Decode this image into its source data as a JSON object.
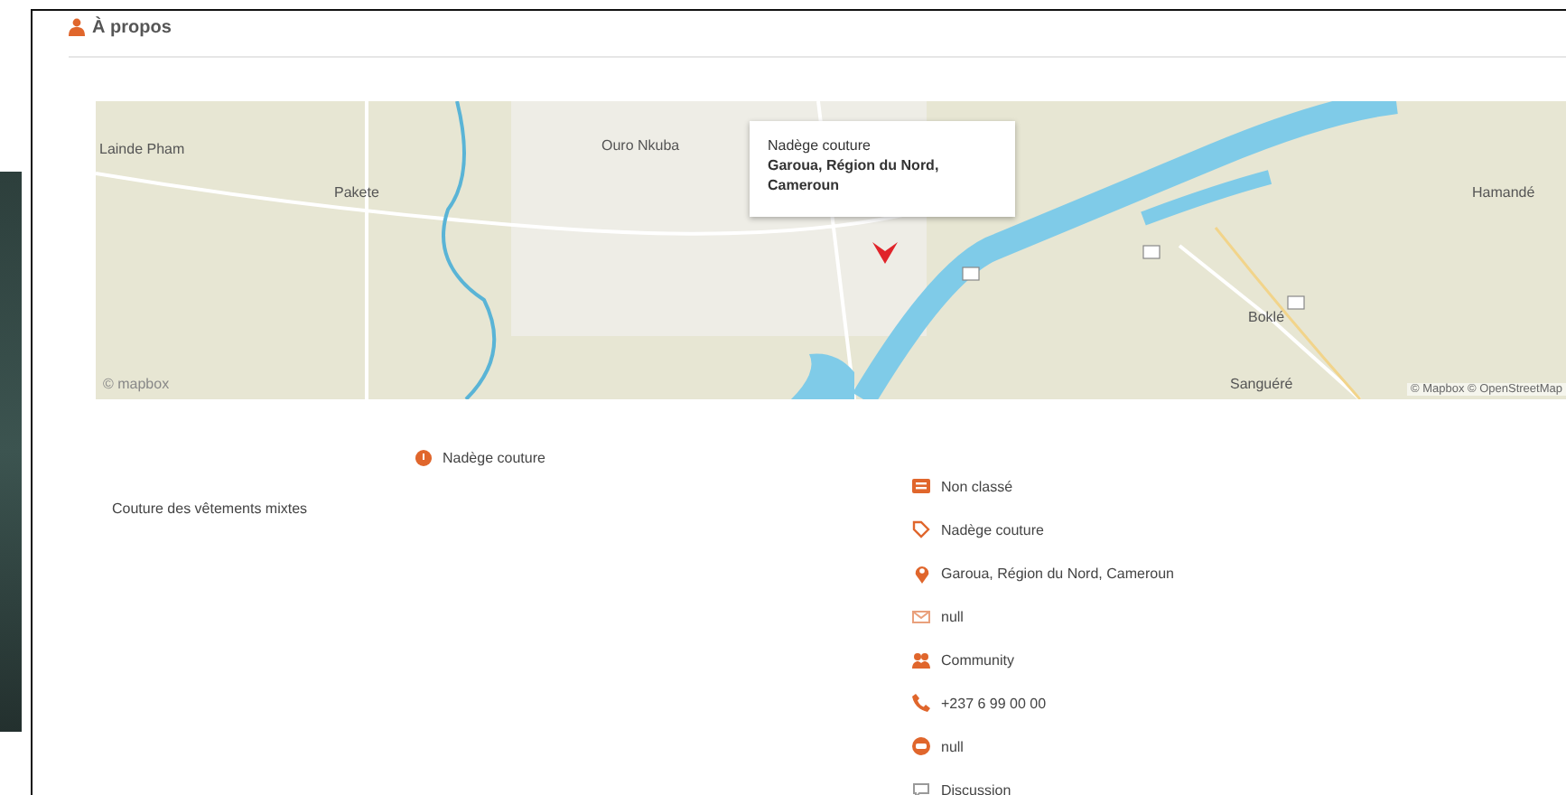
{
  "section": {
    "title": "À propos"
  },
  "map": {
    "labels": [
      {
        "text": "Lainde Pham"
      },
      {
        "text": "Pakete"
      },
      {
        "text": "Ouro Nkuba"
      },
      {
        "text": "Boklé"
      },
      {
        "text": "Hamandé"
      },
      {
        "text": "Sanguéré"
      }
    ],
    "popup": {
      "name": "Nadège couture",
      "address": "Garoua, Région du Nord, Cameroun"
    },
    "logo": "© mapbox",
    "attribution": "© Mapbox © OpenStreetMap"
  },
  "business": {
    "name": "Nadège couture",
    "description": "Couture des vêtements mixtes"
  },
  "details": [
    {
      "kind": "category",
      "text": "Non classé"
    },
    {
      "kind": "shop",
      "text": "Nadège couture"
    },
    {
      "kind": "location",
      "text": "Garoua, Région du Nord, Cameroun"
    },
    {
      "kind": "mail",
      "text": "null"
    },
    {
      "kind": "community",
      "text": "Community"
    },
    {
      "kind": "phone",
      "text": "+237 6 99 00 00"
    },
    {
      "kind": "web",
      "text": "null"
    },
    {
      "kind": "chat",
      "text": "Discussion"
    }
  ]
}
